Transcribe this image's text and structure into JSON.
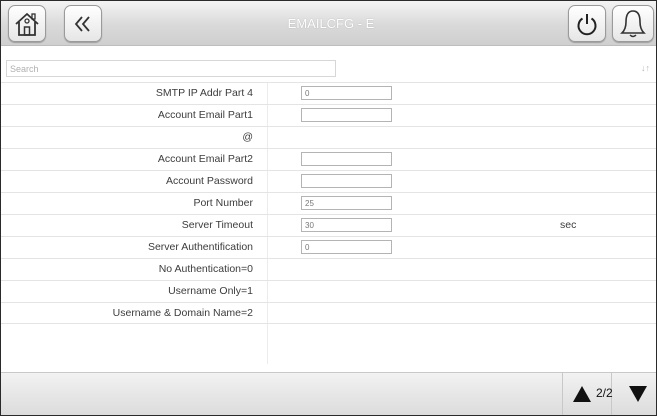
{
  "header": {
    "title": "EMAILCFG - E"
  },
  "search": {
    "placeholder": "Search",
    "sort_glyph": "↓↑"
  },
  "rows": [
    {
      "label": "SMTP IP Addr Part 4",
      "value": "0"
    },
    {
      "label": "Account Email Part1",
      "value": ""
    },
    {
      "label": "@"
    },
    {
      "label": "Account Email Part2",
      "value": ""
    },
    {
      "label": "Account Password",
      "value": ""
    },
    {
      "label": "Port Number",
      "value": "25"
    },
    {
      "label": "Server Timeout",
      "value": "30",
      "unit": "sec"
    },
    {
      "label": "Server Authentification",
      "value": "0"
    },
    {
      "label": "No Authentication=0"
    },
    {
      "label": "Username Only=1"
    },
    {
      "label": "Username & Domain Name=2"
    }
  ],
  "footer": {
    "page": "2/2"
  },
  "icons": {
    "home": "home-icon",
    "back": "double-chevron-left-icon",
    "power": "power-icon",
    "bell": "bell-icon",
    "up": "triangle-up-icon",
    "down": "triangle-down-icon"
  },
  "colors": {
    "header_bg": "#d9d9d9",
    "title_text": "#ffffff",
    "text": "#3c3c3c"
  }
}
